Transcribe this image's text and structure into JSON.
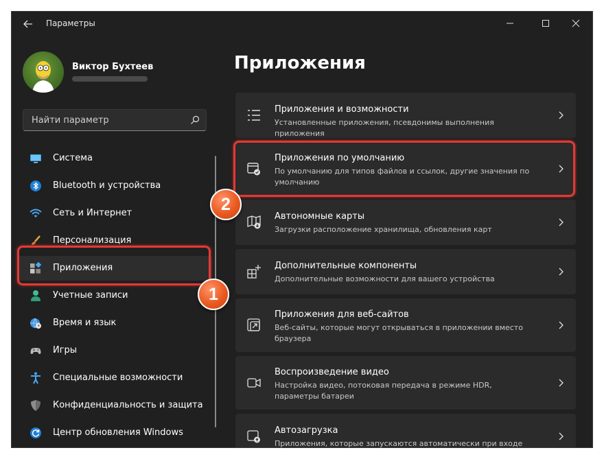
{
  "window": {
    "app_title": "Параметры"
  },
  "user": {
    "name": "Виктор Бухтеев"
  },
  "search": {
    "placeholder": "Найти параметр"
  },
  "sidebar": {
    "items": [
      {
        "label": "Система",
        "icon": "monitor-icon",
        "selected": false
      },
      {
        "label": "Bluetooth и устройства",
        "icon": "bluetooth-icon",
        "selected": false
      },
      {
        "label": "Сеть и Интернет",
        "icon": "wifi-icon",
        "selected": false
      },
      {
        "label": "Персонализация",
        "icon": "brush-icon",
        "selected": false
      },
      {
        "label": "Приложения",
        "icon": "apps-icon",
        "selected": true
      },
      {
        "label": "Учетные записи",
        "icon": "person-icon",
        "selected": false
      },
      {
        "label": "Время и язык",
        "icon": "globe-clock-icon",
        "selected": false
      },
      {
        "label": "Игры",
        "icon": "gamepad-icon",
        "selected": false
      },
      {
        "label": "Специальные возможности",
        "icon": "accessibility-icon",
        "selected": false
      },
      {
        "label": "Конфиденциальность и защита",
        "icon": "shield-icon",
        "selected": false
      },
      {
        "label": "Центр обновления Windows",
        "icon": "update-icon",
        "selected": false
      }
    ]
  },
  "main": {
    "title": "Приложения",
    "cards": [
      {
        "title": "Приложения и возможности",
        "description": "Установленные приложения, псевдонимы выполнения приложения",
        "icon": "apps-list-icon"
      },
      {
        "title": "Приложения по умолчанию",
        "description": "По умолчанию для типов файлов и ссылок, другие значения по умолчанию",
        "icon": "default-apps-icon"
      },
      {
        "title": "Автономные карты",
        "description": "Загрузки расположение хранилища, обновления карт",
        "icon": "offline-map-icon"
      },
      {
        "title": "Дополнительные компоненты",
        "description": "Дополнительные возможности для вашего устройства",
        "icon": "optional-features-icon"
      },
      {
        "title": "Приложения для веб-сайтов",
        "description": "Веб-сайты, которые могут открываться в приложении вместо браузера",
        "icon": "web-apps-icon"
      },
      {
        "title": "Воспроизведение видео",
        "description": "Настройка видео, потоковая передача в режиме HDR, параметры батареи",
        "icon": "video-icon"
      },
      {
        "title": "Автозагрузка",
        "description": "Приложения, которые запускаются автоматически при входе",
        "icon": "startup-icon"
      }
    ]
  },
  "annotations": {
    "badge_1": "1",
    "badge_2": "2",
    "highlight_color": "#e53935",
    "badge_color": "#ea5a23"
  },
  "colors": {
    "accent": "#4cc2ff",
    "window_bg": "#202020",
    "card_bg": "#2b2b2b"
  }
}
